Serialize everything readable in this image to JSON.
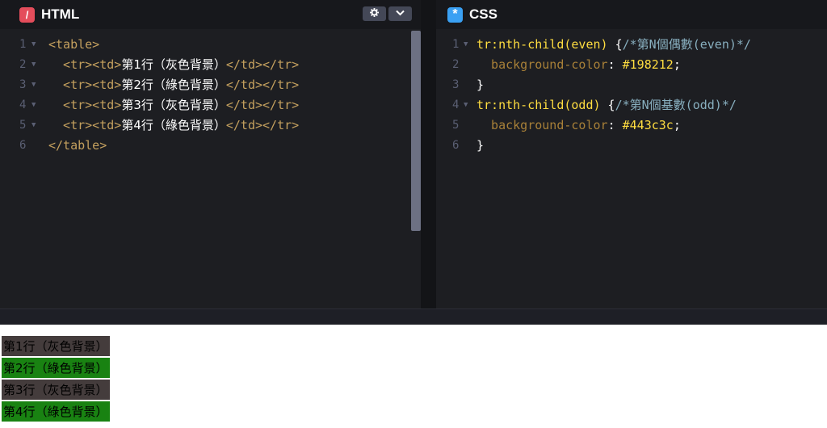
{
  "html_panel": {
    "title": "HTML",
    "icon": "html-icon",
    "settings_icon": "gear-icon",
    "collapse_icon": "chevron-down-icon",
    "lines": [
      {
        "num": "1",
        "folds": true,
        "parts": [
          {
            "t": "tag",
            "v": "<table>"
          }
        ]
      },
      {
        "num": "2",
        "folds": true,
        "parts": [
          {
            "t": "tag",
            "v": "  <tr><td>"
          },
          {
            "t": "cjk",
            "v": "第1行（灰色背景）"
          },
          {
            "t": "tag",
            "v": "</td></tr>"
          }
        ]
      },
      {
        "num": "3",
        "folds": true,
        "parts": [
          {
            "t": "tag",
            "v": "  <tr><td>"
          },
          {
            "t": "cjk",
            "v": "第2行（綠色背景）"
          },
          {
            "t": "tag",
            "v": "</td></tr>"
          }
        ]
      },
      {
        "num": "4",
        "folds": true,
        "parts": [
          {
            "t": "tag",
            "v": "  <tr><td>"
          },
          {
            "t": "cjk",
            "v": "第3行（灰色背景）"
          },
          {
            "t": "tag",
            "v": "</td></tr>"
          }
        ]
      },
      {
        "num": "5",
        "folds": true,
        "parts": [
          {
            "t": "tag",
            "v": "  <tr><td>"
          },
          {
            "t": "cjk",
            "v": "第4行（綠色背景）"
          },
          {
            "t": "tag",
            "v": "</td></tr>"
          }
        ]
      },
      {
        "num": "6",
        "folds": false,
        "parts": [
          {
            "t": "tag",
            "v": "</table>"
          }
        ]
      }
    ]
  },
  "css_panel": {
    "title": "CSS",
    "icon": "css-icon",
    "lines": [
      {
        "num": "1",
        "folds": true,
        "parts": [
          {
            "t": "sel",
            "v": "tr:nth-child(even)"
          },
          {
            "t": "punc",
            "v": " {"
          },
          {
            "t": "cmt",
            "v": "/*第N個偶數(even)*/"
          }
        ]
      },
      {
        "num": "2",
        "folds": false,
        "parts": [
          {
            "t": "prop",
            "v": "  background-color"
          },
          {
            "t": "punc",
            "v": ": "
          },
          {
            "t": "val",
            "v": "#198212"
          },
          {
            "t": "punc",
            "v": ";"
          }
        ]
      },
      {
        "num": "3",
        "folds": false,
        "parts": [
          {
            "t": "punc",
            "v": "}"
          }
        ]
      },
      {
        "num": "4",
        "folds": true,
        "parts": [
          {
            "t": "sel",
            "v": "tr:nth-child(odd)"
          },
          {
            "t": "punc",
            "v": " {"
          },
          {
            "t": "cmt",
            "v": "/*第N個基數(odd)*/"
          }
        ]
      },
      {
        "num": "5",
        "folds": false,
        "parts": [
          {
            "t": "prop",
            "v": "  background-color"
          },
          {
            "t": "punc",
            "v": ": "
          },
          {
            "t": "val",
            "v": "#443c3c"
          },
          {
            "t": "punc",
            "v": ";"
          }
        ]
      },
      {
        "num": "6",
        "folds": false,
        "parts": [
          {
            "t": "punc",
            "v": "}"
          }
        ]
      }
    ]
  },
  "result": {
    "rows": [
      {
        "text": "第1行（灰色背景）",
        "color": "#443c3c"
      },
      {
        "text": "第2行（綠色背景）",
        "color": "#198212"
      },
      {
        "text": "第3行（灰色背景）",
        "color": "#443c3c"
      },
      {
        "text": "第4行（綠色背景）",
        "color": "#198212"
      }
    ]
  }
}
